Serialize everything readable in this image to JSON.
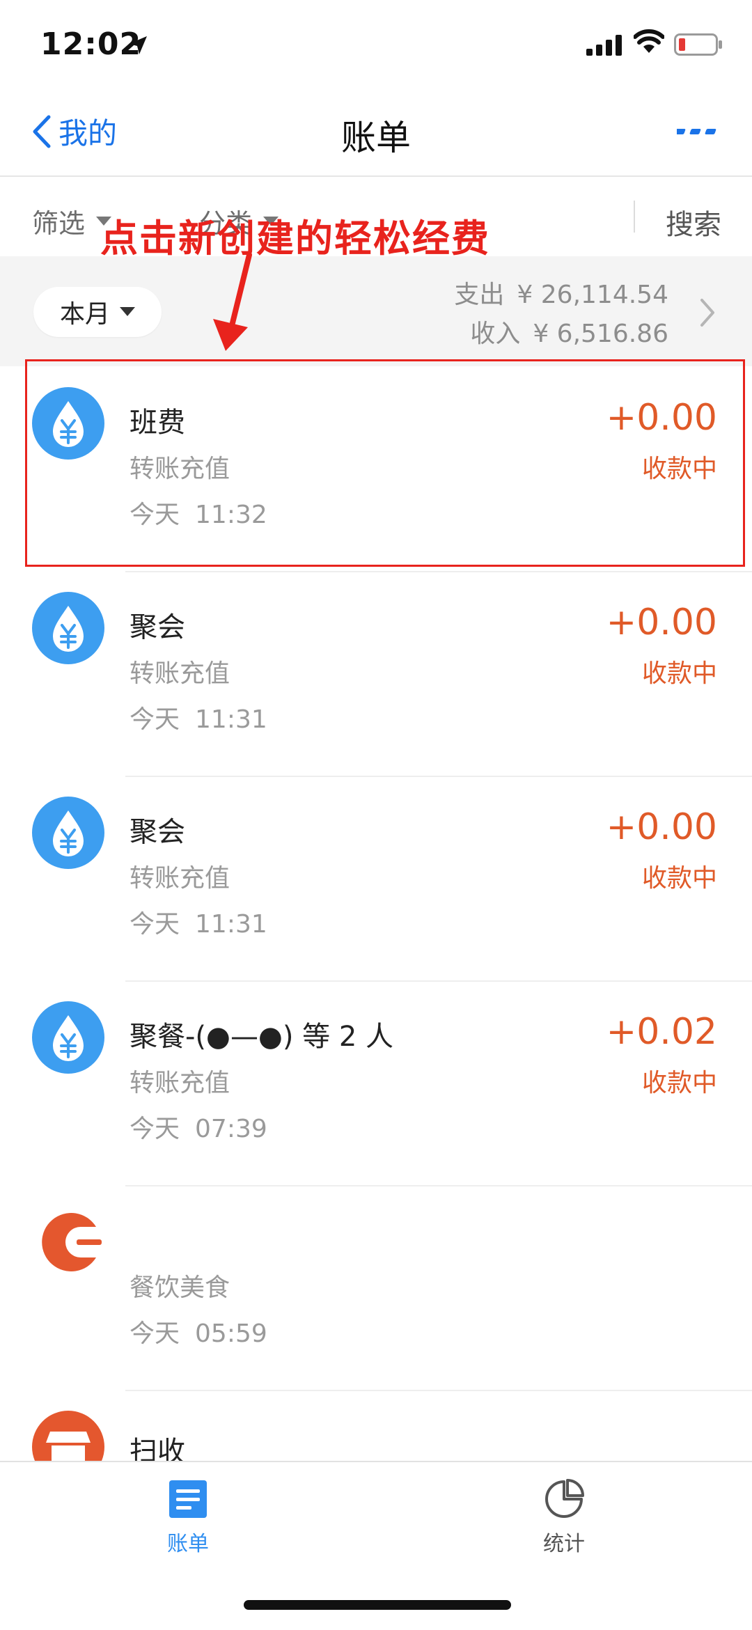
{
  "status_bar": {
    "time": "12:02"
  },
  "nav": {
    "back_label": "我的",
    "title": "账单"
  },
  "filter_bar": {
    "filter_label": "筛选",
    "category_label": "分类",
    "search_label": "搜索"
  },
  "month_bar": {
    "period_label": "本月",
    "expense_label": "支出",
    "expense_amount": "¥ 26,114.54",
    "income_label": "收入",
    "income_amount": "¥ 6,516.86"
  },
  "annotation": {
    "text": "点击新创建的轻松经费",
    "color": "#e8231d"
  },
  "transactions": [
    {
      "name": "班费",
      "category": "转账充值",
      "day": "今天",
      "time": "11:32",
      "amount": "+0.00",
      "status": "收款中",
      "icon": "money-drop-icon"
    },
    {
      "name": "聚会",
      "category": "转账充值",
      "day": "今天",
      "time": "11:31",
      "amount": "+0.00",
      "status": "收款中",
      "icon": "money-drop-icon"
    },
    {
      "name": "聚会",
      "category": "转账充值",
      "day": "今天",
      "time": "11:31",
      "amount": "+0.00",
      "status": "收款中",
      "icon": "money-drop-icon"
    },
    {
      "name": "聚餐-(●—●) 等 2 人",
      "category": "转账充值",
      "day": "今天",
      "time": "07:39",
      "amount": "+0.02",
      "status": "收款中",
      "icon": "money-drop-icon"
    },
    {
      "name": "",
      "category": "餐饮美食",
      "day": "今天",
      "time": "05:59",
      "amount": "",
      "status": "",
      "icon": "dining-icon"
    },
    {
      "name": "扫收",
      "icon": "shop-icon"
    }
  ],
  "tabs": [
    {
      "label": "账单",
      "icon": "bill-list-icon",
      "active": true
    },
    {
      "label": "统计",
      "icon": "pie-chart-icon",
      "active": false
    }
  ],
  "colors": {
    "accent": "#1a73e8",
    "amount": "#e05a28",
    "icon_blue": "#3d9ef0",
    "icon_orange": "#e4572e"
  }
}
